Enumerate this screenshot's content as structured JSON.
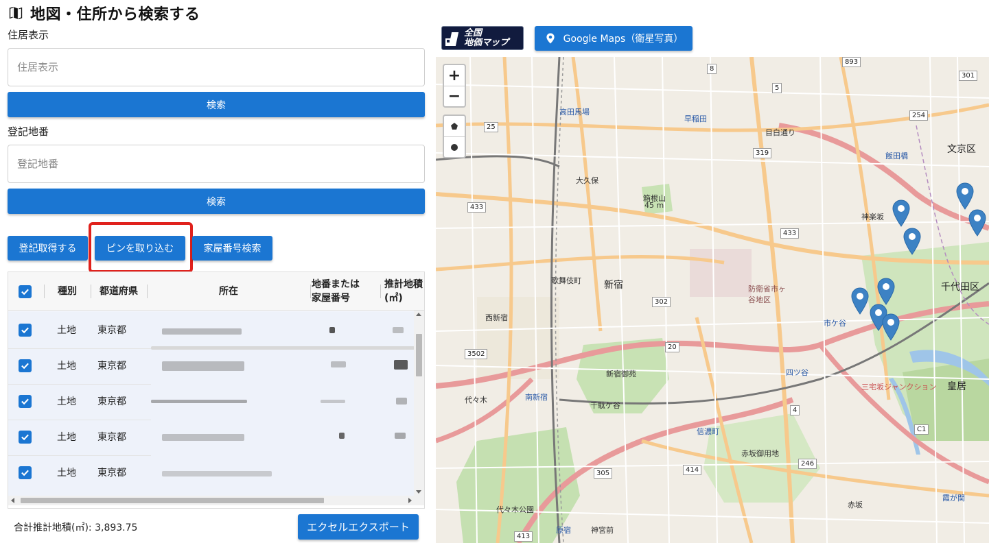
{
  "page": {
    "title": "地図・住所から検索する"
  },
  "address_search": {
    "label": "住居表示",
    "placeholder": "住居表示",
    "value": "",
    "search_label": "検索"
  },
  "registry_search": {
    "label": "登記地番",
    "placeholder": "登記地番",
    "value": "",
    "search_label": "検索"
  },
  "actions": {
    "get_registry": "登記取得する",
    "import_pins": "ピンを取り込む",
    "house_number_search": "家屋番号検索"
  },
  "table": {
    "columns": [
      "種別",
      "都道府県",
      "所在",
      "地番または\n家屋番号",
      "推計地積\n(㎡)"
    ],
    "rows": [
      {
        "type": "土地",
        "prefecture": "東京都"
      },
      {
        "type": "土地",
        "prefecture": "東京都"
      },
      {
        "type": "土地",
        "prefecture": "東京都"
      },
      {
        "type": "土地",
        "prefecture": "東京都"
      },
      {
        "type": "土地",
        "prefecture": "東京都"
      }
    ]
  },
  "footer": {
    "total_label": "合計推計地積(㎡): 3,893.75",
    "export_label": "エクセルエクスポート"
  },
  "map_header": {
    "chika_logo_line1": "全国",
    "chika_logo_line2": "地価マップ",
    "google_maps_label": "Google Maps（衛星写真）"
  },
  "map": {
    "zoom_in": "+",
    "zoom_out": "−",
    "labels": {
      "bunkyo": "文京区",
      "chiyoda": "千代田区",
      "shinjuku": "新宿",
      "okubo": "大久保",
      "takadanobaba": "高田馬場",
      "iidabashi": "飯田橋",
      "yotsuya": "四ツ谷",
      "shinjuku_gyoen": "新宿御苑",
      "yoyogi": "代々木",
      "kokyo": "皇居",
      "akasaka_goyochi": "赤坂御用地",
      "yoyogi_koen": "代々木公園",
      "kagurazaka": "神楽坂",
      "ichigaya": "市ケ谷",
      "sendagaya": "千駄ケ谷",
      "shinanomachi": "信濃町",
      "nishishinjuku": "西新宿",
      "waseda": "早稲田",
      "mejiro": "目白通り",
      "hakoneyama": "箱根山",
      "hakoneyama_alt": "45 m",
      "bouei": "防衛省市ヶ谷地区",
      "kabukicho": "歌舞伎町",
      "minami_shinjuku": "南新宿",
      "harajuku": "原宿",
      "jingumae": "神宮前",
      "sanbancho": "三宅坂ジャンクション",
      "akasaka": "赤坂",
      "kasumigaseki": "霞が関"
    },
    "routes": [
      "8",
      "5",
      "893",
      "301",
      "254",
      "25",
      "319",
      "433",
      "433",
      "302",
      "20",
      "3502",
      "4",
      "414",
      "305",
      "246",
      "413",
      "C1"
    ]
  },
  "colors": {
    "primary": "#1b76d2",
    "highlight": "#e0211c",
    "marker": "#3d82c4"
  }
}
